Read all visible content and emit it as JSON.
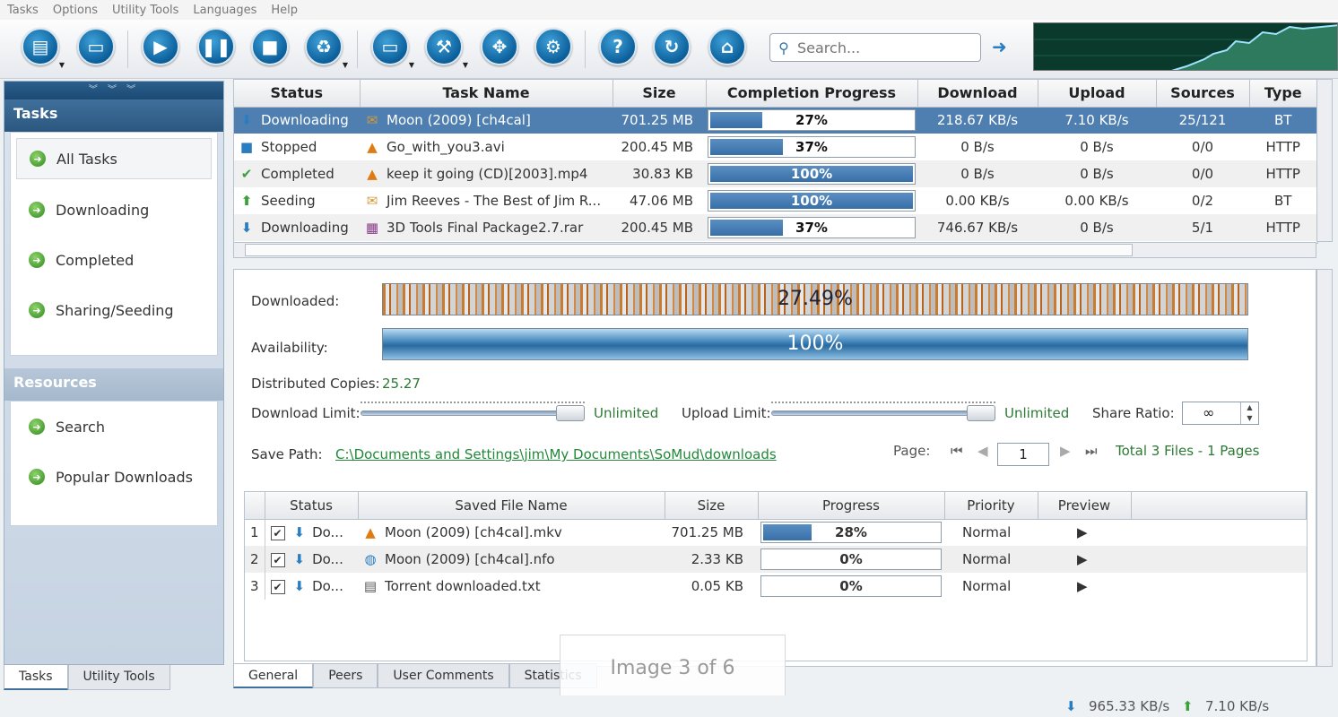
{
  "menu": [
    "Tasks",
    "Options",
    "Utility Tools",
    "Languages",
    "Help"
  ],
  "toolbar": {
    "search_placeholder": "Search...",
    "buttons": [
      "new-task",
      "open",
      "start",
      "pause",
      "stop",
      "delete",
      "folder",
      "tools",
      "fullscreen",
      "settings",
      "help",
      "update",
      "home"
    ]
  },
  "sidebar": {
    "tasks_title": "Tasks",
    "task_items": [
      "All Tasks",
      "Downloading",
      "Completed",
      "Sharing/Seeding"
    ],
    "resources_title": "Resources",
    "resource_items": [
      "Search",
      "Popular Downloads"
    ],
    "tabs": [
      "Tasks",
      "Utility Tools"
    ]
  },
  "tasks_table": {
    "headers": [
      "Status",
      "Task Name",
      "Size",
      "Completion Progress",
      "Download",
      "Upload",
      "Sources",
      "Type"
    ],
    "rows": [
      {
        "status": "Downloading",
        "status_icon": "arrow-down-icon",
        "name": "Moon (2009) [ch4cal]",
        "file_icon": "folder-icon",
        "size": "701.25 MB",
        "progress": 27,
        "progress_label": "27%",
        "download": "218.67 KB/s",
        "upload": "7.10 KB/s",
        "sources": "25/121",
        "type": "BT"
      },
      {
        "status": "Stopped",
        "status_icon": "stop-square-icon",
        "name": "Go_with_you3.avi",
        "file_icon": "vlc-cone-icon",
        "size": "200.45 MB",
        "progress": 37,
        "progress_label": "37%",
        "download": "0 B/s",
        "upload": "0 B/s",
        "sources": "0/0",
        "type": "HTTP"
      },
      {
        "status": "Completed",
        "status_icon": "checkmark-icon",
        "name": "keep it going (CD)[2003].mp4",
        "file_icon": "vlc-cone-icon",
        "size": "30.83 KB",
        "progress": 100,
        "progress_label": "100%",
        "download": "0 B/s",
        "upload": "0 B/s",
        "sources": "0/0",
        "type": "HTTP"
      },
      {
        "status": "Seeding",
        "status_icon": "arrow-up-icon",
        "name": "Jim Reeves - The Best of Jim R...",
        "file_icon": "folder-icon",
        "size": "47.06 MB",
        "progress": 100,
        "progress_label": "100%",
        "download": "0.00 KB/s",
        "upload": "0.00 KB/s",
        "sources": "0/2",
        "type": "BT"
      },
      {
        "status": "Downloading",
        "status_icon": "arrow-down-icon",
        "name": "3D Tools Final Package2.7.rar",
        "file_icon": "archive-icon",
        "size": "200.45 MB",
        "progress": 37,
        "progress_label": "37%",
        "download": "746.67 KB/s",
        "upload": "0 B/s",
        "sources": "5/1",
        "type": "HTTP"
      }
    ]
  },
  "details": {
    "downloaded_label": "Downloaded:",
    "downloaded_value": "27.49%",
    "availability_label": "Availability:",
    "availability_value": "100%",
    "copies_label": "Distributed Copies:",
    "copies_value": "25.27",
    "download_limit_label": "Download Limit:",
    "download_limit_value": "Unlimited",
    "upload_limit_label": "Upload Limit:",
    "upload_limit_value": "Unlimited",
    "share_ratio_label": "Share Ratio:",
    "share_ratio_value": "∞",
    "save_path_label": "Save Path:",
    "save_path_value": "C:\\Documents and Settings\\jim\\My Documents\\SoMud\\downloads",
    "page_label": "Page:",
    "page_value": "1",
    "total_label": "Total 3 Files - 1 Pages"
  },
  "files_table": {
    "headers": [
      "Status",
      "Saved File Name",
      "Size",
      "Progress",
      "Priority",
      "Preview"
    ],
    "rows": [
      {
        "index": "1",
        "status": "Do...",
        "name": "Moon  (2009) [ch4cal].mkv",
        "file_icon": "vlc-cone-icon",
        "size": "701.25 MB",
        "progress": 28,
        "progress_label": "28%",
        "priority": "Normal"
      },
      {
        "index": "2",
        "status": "Do...",
        "name": "Moon (2009) [ch4cal].nfo",
        "file_icon": "globe-icon",
        "size": "2.33 KB",
        "progress": 0,
        "progress_label": "0%",
        "priority": "Normal"
      },
      {
        "index": "3",
        "status": "Do...",
        "name": "Torrent downloaded.txt",
        "file_icon": "text-file-icon",
        "size": "0.05 KB",
        "progress": 0,
        "progress_label": "0%",
        "priority": "Normal"
      }
    ]
  },
  "detail_tabs": [
    "General",
    "Peers",
    "User Comments",
    "Statistics"
  ],
  "caption": "Image 3 of 6",
  "status_bar": {
    "down_speed": "965.33 KB/s",
    "up_speed": "7.10 KB/s"
  },
  "colors": {
    "accent": "#2a5780",
    "progress": "#4a7fb5",
    "link": "#23883a",
    "graph_bg": "#0a3a2c"
  }
}
